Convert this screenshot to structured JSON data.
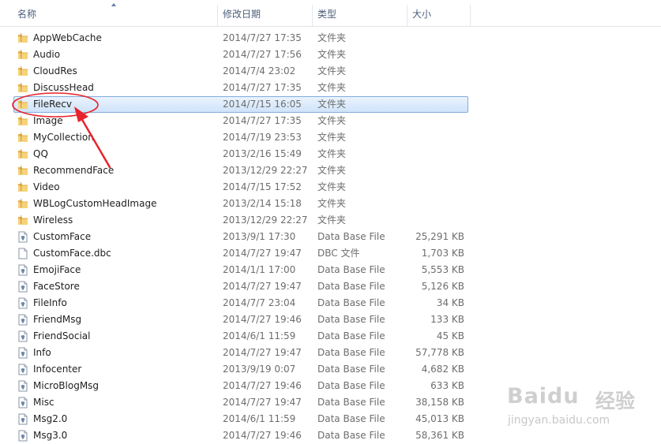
{
  "columns": {
    "name": "名称",
    "date": "修改日期",
    "type": "类型",
    "size": "大小"
  },
  "files": [
    {
      "name": "AppWebCache",
      "date": "2014/7/27 17:35",
      "type": "文件夹",
      "size": "",
      "kind": "folder"
    },
    {
      "name": "Audio",
      "date": "2014/7/27 17:56",
      "type": "文件夹",
      "size": "",
      "kind": "folder"
    },
    {
      "name": "CloudRes",
      "date": "2014/7/4 23:02",
      "type": "文件夹",
      "size": "",
      "kind": "folder"
    },
    {
      "name": "DiscussHead",
      "date": "2014/7/27 17:35",
      "type": "文件夹",
      "size": "",
      "kind": "folder"
    },
    {
      "name": "FileRecv",
      "date": "2014/7/15 16:05",
      "type": "文件夹",
      "size": "",
      "kind": "folder",
      "selected": true
    },
    {
      "name": "Image",
      "date": "2014/7/27 17:35",
      "type": "文件夹",
      "size": "",
      "kind": "folder"
    },
    {
      "name": "MyCollection",
      "date": "2014/7/19 23:53",
      "type": "文件夹",
      "size": "",
      "kind": "folder"
    },
    {
      "name": "QQ",
      "date": "2013/2/16 15:49",
      "type": "文件夹",
      "size": "",
      "kind": "folder"
    },
    {
      "name": "RecommendFace",
      "date": "2013/12/29 22:27",
      "type": "文件夹",
      "size": "",
      "kind": "folder"
    },
    {
      "name": "Video",
      "date": "2014/7/15 17:52",
      "type": "文件夹",
      "size": "",
      "kind": "folder"
    },
    {
      "name": "WBLogCustomHeadImage",
      "date": "2013/2/14 15:18",
      "type": "文件夹",
      "size": "",
      "kind": "folder"
    },
    {
      "name": "Wireless",
      "date": "2013/12/29 22:27",
      "type": "文件夹",
      "size": "",
      "kind": "folder"
    },
    {
      "name": "CustomFace",
      "date": "2013/9/1 17:30",
      "type": "Data Base File",
      "size": "25,291 KB",
      "kind": "db"
    },
    {
      "name": "CustomFace.dbc",
      "date": "2014/7/27 19:47",
      "type": "DBC 文件",
      "size": "1,703 KB",
      "kind": "file"
    },
    {
      "name": "EmojiFace",
      "date": "2014/1/1 17:00",
      "type": "Data Base File",
      "size": "5,553 KB",
      "kind": "db"
    },
    {
      "name": "FaceStore",
      "date": "2014/7/27 19:47",
      "type": "Data Base File",
      "size": "5,126 KB",
      "kind": "db"
    },
    {
      "name": "FileInfo",
      "date": "2014/7/7 23:04",
      "type": "Data Base File",
      "size": "34 KB",
      "kind": "db"
    },
    {
      "name": "FriendMsg",
      "date": "2014/7/27 19:46",
      "type": "Data Base File",
      "size": "133 KB",
      "kind": "db"
    },
    {
      "name": "FriendSocial",
      "date": "2014/6/1 11:59",
      "type": "Data Base File",
      "size": "45 KB",
      "kind": "db"
    },
    {
      "name": "Info",
      "date": "2014/7/27 19:47",
      "type": "Data Base File",
      "size": "57,778 KB",
      "kind": "db"
    },
    {
      "name": "Infocenter",
      "date": "2013/9/19 0:07",
      "type": "Data Base File",
      "size": "4,682 KB",
      "kind": "db"
    },
    {
      "name": "MicroBlogMsg",
      "date": "2014/7/27 19:46",
      "type": "Data Base File",
      "size": "633 KB",
      "kind": "db"
    },
    {
      "name": "Misc",
      "date": "2014/7/27 19:47",
      "type": "Data Base File",
      "size": "38,158 KB",
      "kind": "db"
    },
    {
      "name": "Msg2.0",
      "date": "2014/6/1 11:59",
      "type": "Data Base File",
      "size": "45,013 KB",
      "kind": "db"
    },
    {
      "name": "Msg3.0",
      "date": "2014/7/27 19:46",
      "type": "Data Base File",
      "size": "58,361 KB",
      "kind": "db"
    }
  ],
  "watermark": {
    "brand": "Baidu",
    "brand_cn": "经验",
    "url": "jingyan.baidu.com"
  },
  "colors": {
    "selection_fill": "#cfe3f9",
    "selection_border": "#84acdd",
    "annotation_red": "#e8232b",
    "folder": "#f2c55c"
  }
}
